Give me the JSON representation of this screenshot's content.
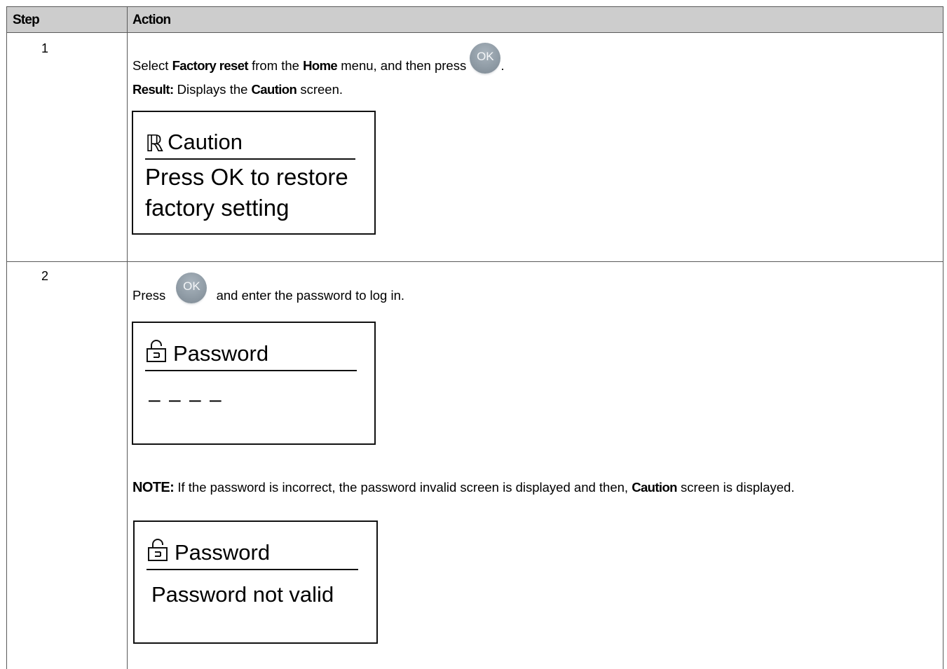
{
  "table": {
    "headers": {
      "step": "Step",
      "action": "Action"
    },
    "rows": [
      {
        "step": "1",
        "line1": {
          "pre": "Select ",
          "b1": "Factory reset",
          "mid": " from the ",
          "b2": "Home",
          "post": " menu, and then press ",
          "end": "."
        },
        "ok_label": "OK",
        "line2": {
          "b": "Result:",
          "pre": " Displays the ",
          "b2": "Caution",
          "post": " screen."
        },
        "screen": {
          "icon": "reset-r-icon",
          "icon_glyph": "ℝ",
          "title": "Caution",
          "body_line1": "Press OK to restore",
          "body_line2": "factory setting"
        }
      },
      {
        "step": "2",
        "line1": {
          "pre": "Press ",
          "post": " and enter the password to log in."
        },
        "ok_label": "OK",
        "screen_a": {
          "icon": "lock-icon",
          "title": "Password",
          "placeholder": "– – – –"
        },
        "note": {
          "b": "NOTE:",
          "pre": " If the password is incorrect, the password invalid screen is displayed and then, ",
          "b2": "Caution",
          "post": " screen is displayed."
        },
        "screen_b": {
          "icon": "lock-icon",
          "title": "Password",
          "body": "Password not valid"
        }
      }
    ]
  }
}
